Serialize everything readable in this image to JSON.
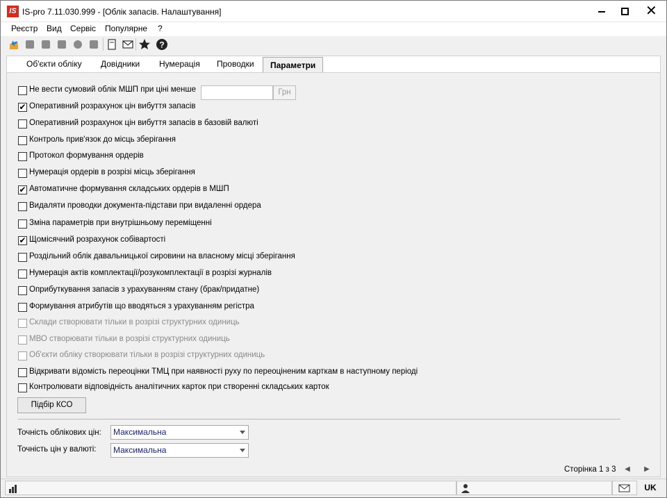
{
  "window": {
    "title": "IS-pro 7.11.030.999 - [Облік запасів. Налаштування]",
    "logo_text": "IS"
  },
  "menu": [
    "Реєстр",
    "Вид",
    "Сервіс",
    "Популярне",
    "?"
  ],
  "toolbar": {
    "icons": [
      "refresh-icon",
      "add-icon",
      "edit-icon",
      "copy-icon",
      "delete-icon",
      "print-icon",
      "document-icon",
      "mail-icon",
      "favorite-star-icon",
      "help-icon"
    ]
  },
  "tabs": [
    {
      "label": "Об'єкти обліку",
      "active": false
    },
    {
      "label": "Довідники",
      "active": false
    },
    {
      "label": "Нумерація",
      "active": false
    },
    {
      "label": "Проводки",
      "active": false
    },
    {
      "label": "Параметри",
      "active": true
    }
  ],
  "options": [
    {
      "label": "Не вести сумовий облік МШП при ціні менше",
      "checked": false,
      "disabled": false
    },
    {
      "label": "Оперативний розрахунок цін вибуття запасів",
      "checked": true,
      "disabled": false
    },
    {
      "label": "Оперативний розрахунок цін вибуття запасів в базовій валюті",
      "checked": false,
      "disabled": false
    },
    {
      "label": "Контроль прив'язок до місць зберігання",
      "checked": false,
      "disabled": false
    },
    {
      "label": "Протокол формування ордерів",
      "checked": false,
      "disabled": false
    },
    {
      "label": "Нумерація ордерів в розрізі місць зберігання",
      "checked": false,
      "disabled": false
    },
    {
      "label": "Автоматичне формування складських ордерів в МШП",
      "checked": true,
      "disabled": false
    },
    {
      "label": "Видаляти проводки документа-підстави при видаленні ордера",
      "checked": false,
      "disabled": false
    },
    {
      "label": "Зміна параметрів при внутрішньому переміщенні",
      "checked": false,
      "disabled": false
    },
    {
      "label": "Щомісячний розрахунок собівартості",
      "checked": true,
      "disabled": false
    },
    {
      "label": "Роздільний облік давальницької сировини на власному місці зберігання",
      "checked": false,
      "disabled": false
    },
    {
      "label": "Нумерація актів комплектації/розукомплектації в розрізі журналів",
      "checked": false,
      "disabled": false
    },
    {
      "label": "Оприбуткування запасів з урахуванням стану (брак/придатне)",
      "checked": false,
      "disabled": false
    },
    {
      "label": "Формування атрибутів що вводяться з урахуванням регістра",
      "checked": false,
      "disabled": false
    },
    {
      "label": "Склади створювати тільки в розрізі структурних одиниць",
      "checked": false,
      "disabled": true
    },
    {
      "label": "МВО створювати тільки в розрізі структурних одиниць",
      "checked": false,
      "disabled": true
    },
    {
      "label": "Об'єкти обліку створювати тільки в розрізі структурних одиниць",
      "checked": false,
      "disabled": true
    },
    {
      "label": "Відкривати відомість переоцінки ТМЦ при наявності руху по переоціненим карткам в наступному періоді",
      "checked": false,
      "disabled": false
    },
    {
      "label": "Контролювати відповідність аналітичних карток при створенні складських карток",
      "checked": false,
      "disabled": false
    }
  ],
  "threshold": {
    "value": "",
    "unit": "Грн"
  },
  "kso_button": "Підбір КСО",
  "precision": {
    "accounting_label": "Точність облікових цін:",
    "accounting_value": "Максимальна",
    "currency_label": "Точність цін у валюті:",
    "currency_value": "Максимальна"
  },
  "pager": {
    "text": "Сторінка 1 з 3"
  },
  "status": {
    "locale": "UK"
  }
}
